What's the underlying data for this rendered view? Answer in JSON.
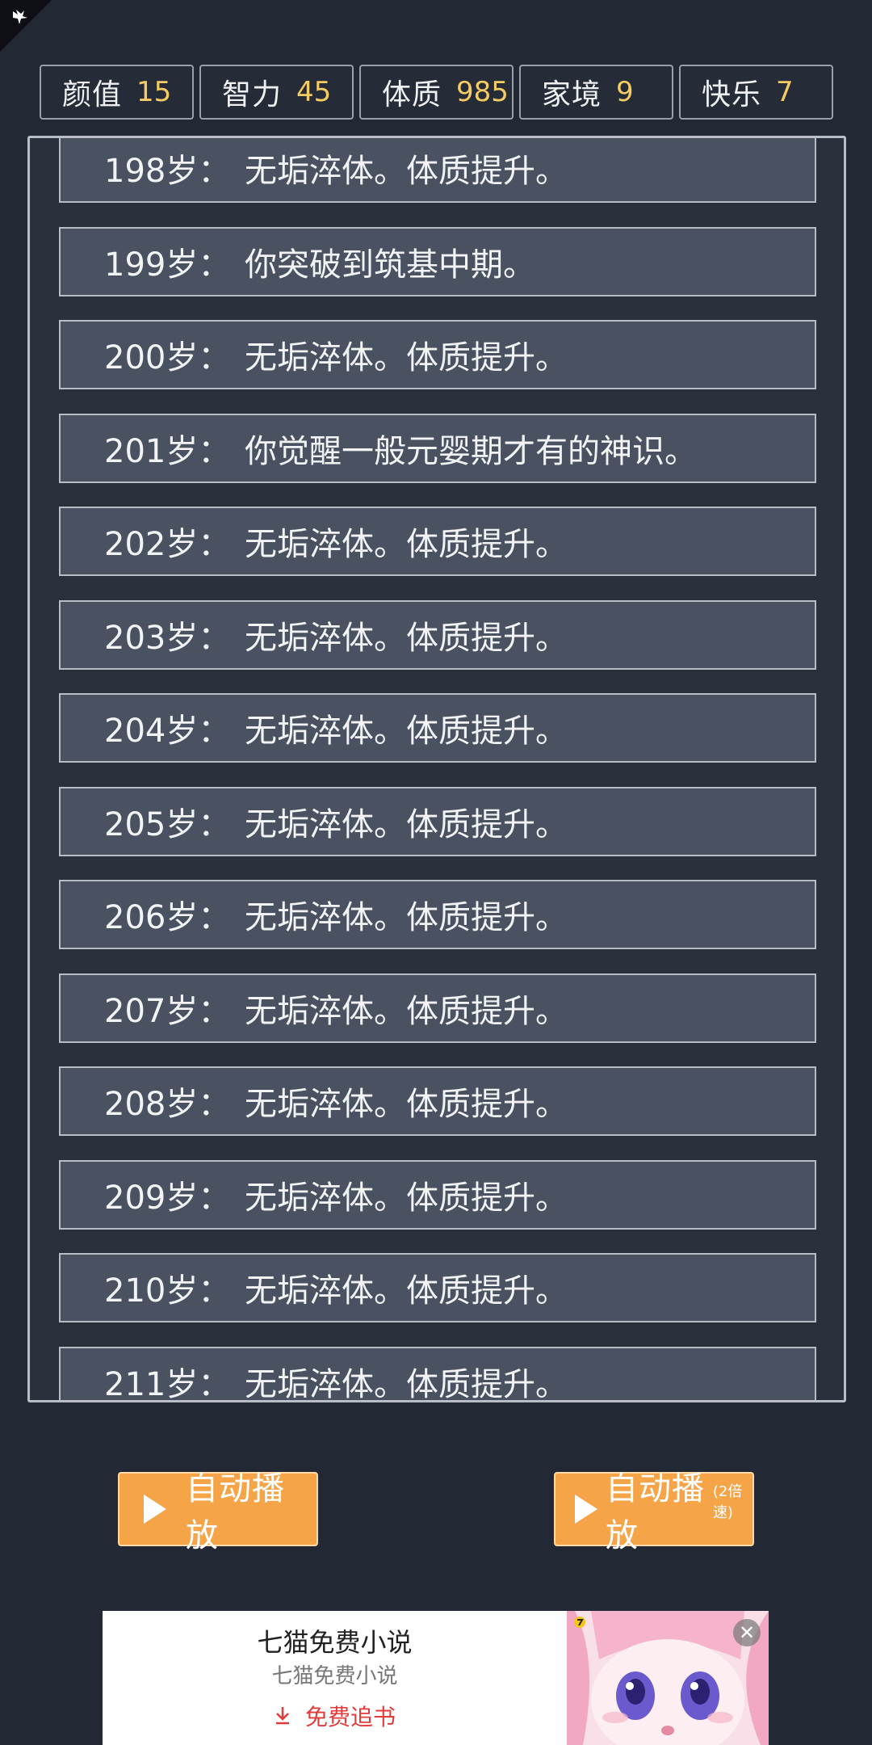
{
  "stats": [
    {
      "label": "颜值",
      "value": "15"
    },
    {
      "label": "智力",
      "value": "45"
    },
    {
      "label": "体质",
      "value": "985"
    },
    {
      "label": "家境",
      "value": "9"
    },
    {
      "label": "快乐",
      "value": "7"
    }
  ],
  "log": [
    {
      "age": "198岁：",
      "text": "无垢淬体。体质提升。"
    },
    {
      "age": "199岁：",
      "text": "你突破到筑基中期。"
    },
    {
      "age": "200岁：",
      "text": "无垢淬体。体质提升。"
    },
    {
      "age": "201岁：",
      "text": "你觉醒一般元婴期才有的神识。"
    },
    {
      "age": "202岁：",
      "text": "无垢淬体。体质提升。"
    },
    {
      "age": "203岁：",
      "text": "无垢淬体。体质提升。"
    },
    {
      "age": "204岁：",
      "text": "无垢淬体。体质提升。"
    },
    {
      "age": "205岁：",
      "text": "无垢淬体。体质提升。"
    },
    {
      "age": "206岁：",
      "text": "无垢淬体。体质提升。"
    },
    {
      "age": "207岁：",
      "text": "无垢淬体。体质提升。"
    },
    {
      "age": "208岁：",
      "text": "无垢淬体。体质提升。"
    },
    {
      "age": "209岁：",
      "text": "无垢淬体。体质提升。"
    },
    {
      "age": "210岁：",
      "text": "无垢淬体。体质提升。"
    },
    {
      "age": "211岁：",
      "text": "无垢淬体。体质提升。"
    }
  ],
  "buttons": {
    "auto_play": "自动播放",
    "auto_play_2x": "自动播放",
    "auto_play_2x_sub": "(2倍速)"
  },
  "ad": {
    "title": "七猫免费小说",
    "subtitle": "七猫免费小说",
    "cta": "免费追书",
    "close": "✕"
  },
  "colors": {
    "background": "#222834",
    "row": "#4a5261",
    "accent": "#f6a448",
    "stat_value": "#f5cc63"
  }
}
